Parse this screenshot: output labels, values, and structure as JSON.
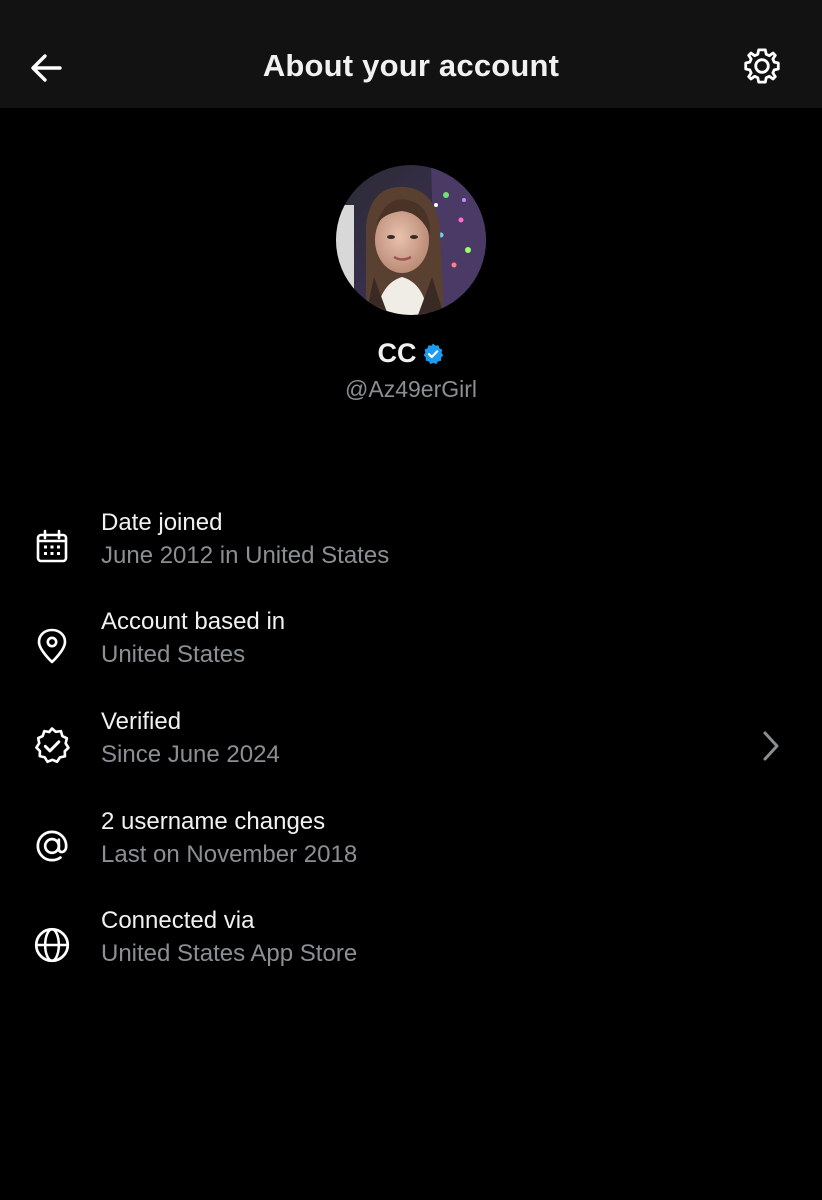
{
  "header": {
    "title": "About your account",
    "back_icon": "arrow-left-icon",
    "settings_icon": "gear-icon"
  },
  "profile": {
    "display_name": "CC",
    "handle": "@Az49erGirl",
    "verified_badge_color": "#1d9bf0",
    "avatar_icon": "profile-photo"
  },
  "info_items": [
    {
      "icon": "calendar-icon",
      "title": "Date joined",
      "subtitle": "June 2012 in United States"
    },
    {
      "icon": "location-pin-icon",
      "title": "Account based in",
      "subtitle": "United States"
    },
    {
      "icon": "verified-check-icon",
      "title": "Verified",
      "subtitle": "Since June 2024",
      "has_chevron": true
    },
    {
      "icon": "at-sign-icon",
      "title": "2 username changes",
      "subtitle": "Last on November 2018"
    },
    {
      "icon": "globe-icon",
      "title": "Connected via",
      "subtitle": "United States App Store"
    }
  ],
  "colors": {
    "background": "#000000",
    "header_background": "#121212",
    "primary_text": "#f1f1f1",
    "secondary_text": "#8b8f94",
    "accent": "#1d9bf0"
  }
}
